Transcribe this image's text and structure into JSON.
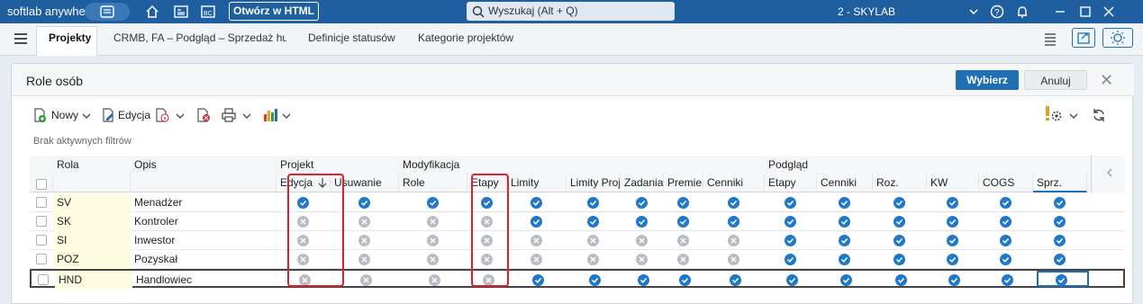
{
  "titlebar": {
    "brand": "softlab anywhere",
    "open_html": "Otwórz w HTML",
    "search_placeholder": "Wyszukaj (Alt + Q)",
    "workspace": "2 - SKYLAB"
  },
  "tabs": [
    {
      "label": "Projekty",
      "active": true
    },
    {
      "label": "CRMB, FA – Podgląd – Sprzedaż hurto",
      "active": false
    },
    {
      "label": "Definicje statusów",
      "active": false
    },
    {
      "label": "Kategorie projektów",
      "active": false
    }
  ],
  "dialog": {
    "title": "Role osób",
    "select_button": "Wybierz",
    "cancel_button": "Anuluj"
  },
  "toolbar": {
    "new_label": "Nowy",
    "edit_label": "Edycja"
  },
  "filters_text": "Brak aktywnych filtrów",
  "groups": [
    "Projekt",
    "Modyfikacja",
    "Podgląd"
  ],
  "columns": {
    "rola": "Rola",
    "opis": "Opis",
    "perm": [
      "Edycja",
      "Usuwanie",
      "Role",
      "Etapy",
      "Limity",
      "Limity Projektu",
      "Zadania",
      "Premie",
      "Cenniki",
      "Etapy",
      "Cenniki",
      "Roz.",
      "KW",
      "COGS",
      "Sprz."
    ]
  },
  "rows": [
    {
      "rola": "SV",
      "opis": "Menadżer",
      "perm": [
        1,
        1,
        1,
        1,
        1,
        1,
        1,
        1,
        1,
        1,
        1,
        1,
        1,
        1,
        1
      ]
    },
    {
      "rola": "SK",
      "opis": "Kontroler",
      "perm": [
        0,
        0,
        0,
        0,
        1,
        1,
        1,
        1,
        1,
        1,
        1,
        1,
        1,
        1,
        1
      ]
    },
    {
      "rola": "SI",
      "opis": "Inwestor",
      "perm": [
        0,
        0,
        0,
        0,
        0,
        0,
        0,
        0,
        0,
        1,
        1,
        1,
        1,
        1,
        1
      ]
    },
    {
      "rola": "POZ",
      "opis": "Pozyskał",
      "perm": [
        0,
        0,
        0,
        0,
        0,
        0,
        0,
        0,
        0,
        1,
        1,
        1,
        1,
        1,
        1
      ]
    },
    {
      "rola": "HND",
      "opis": "Handlowiec",
      "perm": [
        0,
        0,
        0,
        0,
        1,
        1,
        1,
        1,
        1,
        1,
        1,
        1,
        1,
        1,
        1
      ]
    }
  ],
  "colors": {
    "accent": "#1f5fa0",
    "check": "#1f78c8",
    "cross": "#b8bdc3",
    "highlight": "#e0202a"
  }
}
